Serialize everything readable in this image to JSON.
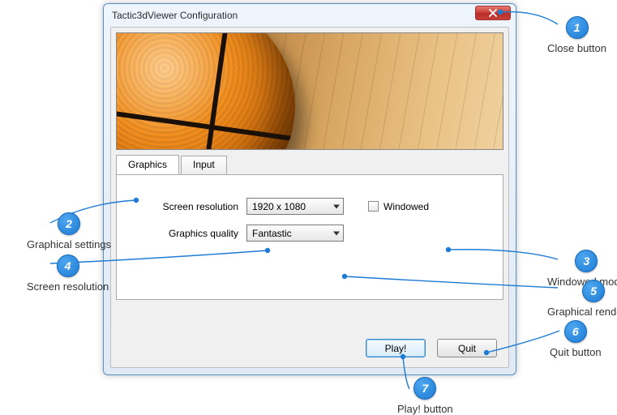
{
  "window": {
    "title": "Tactic3dViewer Configuration"
  },
  "tabs": {
    "items": [
      {
        "label": "Graphics",
        "active": true
      },
      {
        "label": "Input",
        "active": false
      }
    ]
  },
  "graphics": {
    "resolution_label": "Screen resolution",
    "resolution_value": "1920 x 1080",
    "quality_label": "Graphics quality",
    "quality_value": "Fantastic",
    "windowed_label": "Windowed",
    "windowed_checked": false
  },
  "buttons": {
    "play_label": "Play!",
    "quit_label": "Quit"
  },
  "callouts": {
    "c1": {
      "num": "1",
      "text": "Close button"
    },
    "c2": {
      "num": "2",
      "text": "Graphical settings"
    },
    "c3": {
      "num": "3",
      "text": "Windowed mode"
    },
    "c4": {
      "num": "4",
      "text": "Screen resolution"
    },
    "c5": {
      "num": "5",
      "text": "Graphical rendering"
    },
    "c6": {
      "num": "6",
      "text": "Quit button"
    },
    "c7": {
      "num": "7",
      "text": "Play! button"
    }
  }
}
